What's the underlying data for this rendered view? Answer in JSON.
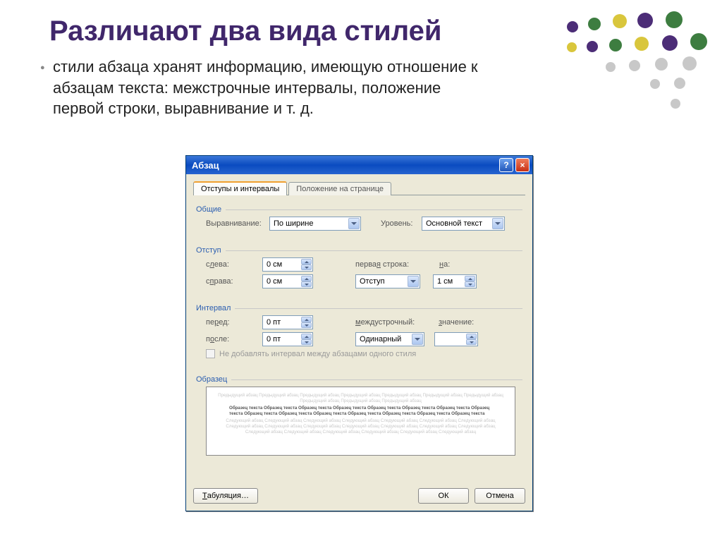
{
  "slide": {
    "title": "Различают два вида стилей",
    "bullet": "стили абзаца хранят информацию, имеющую отношение к абзацам текста: межстрочные интервалы, положение первой строки, выравнивание и т. д."
  },
  "dialog": {
    "title": "Абзац",
    "help_icon": "?",
    "close_icon": "×",
    "tabs": {
      "indents": "Отступы и интервалы",
      "position": "Положение на странице"
    },
    "general": {
      "legend": "Общие",
      "alignment_label": "Выравнивание:",
      "alignment_value": "По ширине",
      "level_label": "Уровень:",
      "level_value": "Основной текст"
    },
    "indent": {
      "legend": "Отступ",
      "left_label": "слева:",
      "left_value": "0 см",
      "right_label": "справа:",
      "right_value": "0 см",
      "first_line_label": "первая строка:",
      "first_line_value": "Отступ",
      "by_label": "на:",
      "by_value": "1 см"
    },
    "spacing": {
      "legend": "Интервал",
      "before_label": "перед:",
      "before_value": "0 пт",
      "after_label": "после:",
      "after_value": "0 пт",
      "line_label": "междустрочный:",
      "line_value": "Одинарный",
      "at_label": "значение:",
      "at_value": "",
      "suppress_check": "Не добавлять интервал между абзацами одного стиля"
    },
    "preview": {
      "legend": "Образец",
      "faint1": "Предыдущий абзац Предыдущий абзац Предыдущий абзац Предыдущий абзац Предыдущий абзац Предыдущий абзац Предыдущий абзац Предыдущий абзац Предыдущий абзац Предыдущий абзац",
      "strong": "Образец текста Образец текста Образец текста Образец текста Образец текста Образец текста Образец текста Образец текста Образец текста Образец текста Образец текста Образец текста Образец текста Образец текста Образец текста",
      "faint2": "Следующий абзац Следующий абзац Следующий абзац Следующий абзац Следующий абзац Следующий абзац Следующий абзац Следующий абзац Следующий абзац Следующий абзац Следующий абзац Следующий абзац Следующий абзац Следующий абзац Следующий абзац Следующий абзац Следующий абзац Следующий абзац Следующий абзац Следующий абзац"
    },
    "buttons": {
      "tabs": "Табуляция…",
      "ok": "ОК",
      "cancel": "Отмена"
    }
  }
}
